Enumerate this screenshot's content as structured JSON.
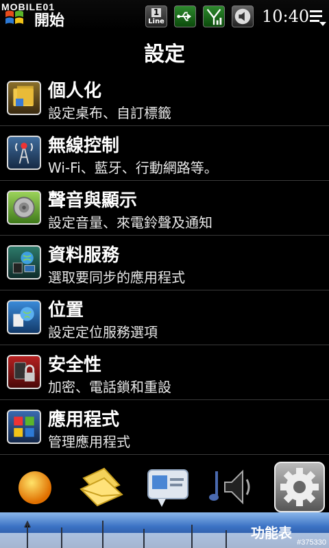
{
  "status_bar": {
    "watermark": "MOBILE01",
    "start_label": "開始",
    "line_number": "1",
    "line_label": "Line",
    "time": "10:40"
  },
  "page_title": "設定",
  "items": [
    {
      "label": "個人化",
      "desc": "設定桌布、自訂標籤"
    },
    {
      "label": "無線控制",
      "desc": "Wi-Fi、藍牙、行動網路等。"
    },
    {
      "label": "聲音與顯示",
      "desc": "設定音量、來電鈴聲及通知"
    },
    {
      "label": "資料服務",
      "desc": "選取要同步的應用程式"
    },
    {
      "label": "位置",
      "desc": "設定定位服務選項"
    },
    {
      "label": "安全性",
      "desc": "加密、電話鎖和重設"
    },
    {
      "label": "應用程式",
      "desc": "管理應用程式"
    }
  ],
  "dock": {
    "icons": [
      "weather-icon",
      "messaging-icon",
      "contact-card-icon",
      "music-icon",
      "settings-gear-icon"
    ]
  },
  "footer": {
    "menu_label": "功能表",
    "watermark_id": "#375330"
  }
}
